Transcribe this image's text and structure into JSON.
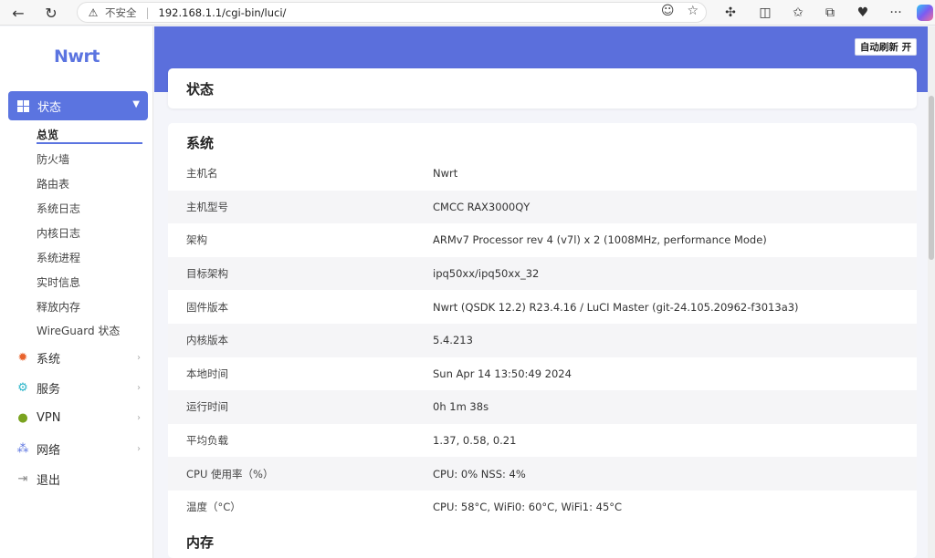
{
  "browser": {
    "insecure_label": "不安全",
    "url": "192.168.1.1/cgi-bin/luci/"
  },
  "sidebar": {
    "logo": "Nwrt",
    "active_menu": "状态",
    "sub_items": [
      "总览",
      "防火墙",
      "路由表",
      "系统日志",
      "内核日志",
      "系统进程",
      "实时信息",
      "释放内存",
      "WireGuard 状态"
    ],
    "menu_items": [
      "系统",
      "服务",
      "VPN",
      "网络",
      "退出"
    ]
  },
  "header": {
    "autorefresh": "自动刷新 开",
    "page_title": "状态"
  },
  "system": {
    "title": "系统",
    "rows": [
      {
        "key": "主机名",
        "value": "Nwrt"
      },
      {
        "key": "主机型号",
        "value": "CMCC RAX3000QY"
      },
      {
        "key": "架构",
        "value": "ARMv7 Processor rev 4 (v7l) x 2 (1008MHz, performance Mode)"
      },
      {
        "key": "目标架构",
        "value": "ipq50xx/ipq50xx_32"
      },
      {
        "key": "固件版本",
        "value": "Nwrt (QSDK 12.2) R23.4.16 / LuCI Master (git-24.105.20962-f3013a3)"
      },
      {
        "key": "内核版本",
        "value": "5.4.213"
      },
      {
        "key": "本地时间",
        "value": "Sun Apr 14 13:50:49 2024"
      },
      {
        "key": "运行时间",
        "value": "0h 1m 38s"
      },
      {
        "key": "平均负载",
        "value": "1.37, 0.58, 0.21"
      },
      {
        "key": "CPU 使用率（%）",
        "value": "CPU: 0% NSS: 4%"
      },
      {
        "key": "温度（°C）",
        "value": "CPU: 58°C, WiFi0: 60°C, WiFi1: 45°C"
      }
    ]
  },
  "memory": {
    "title": "内存"
  },
  "colors": {
    "accent": "#5b74e0",
    "header_band": "#5b6fdc"
  }
}
